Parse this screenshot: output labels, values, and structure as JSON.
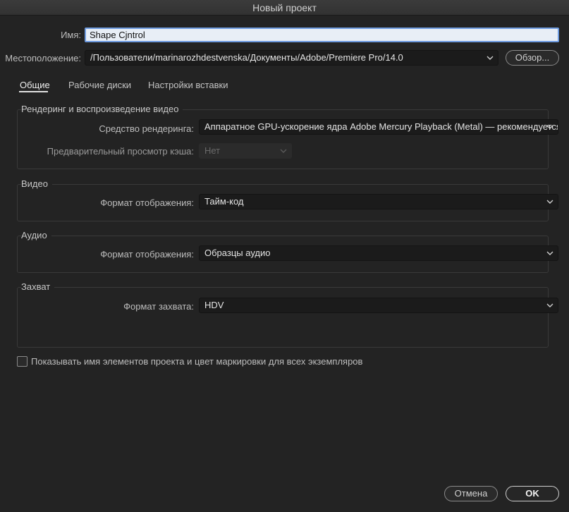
{
  "window": {
    "title": "Новый проект"
  },
  "name": {
    "label": "Имя:",
    "value": "Shape Cjntrol"
  },
  "location": {
    "label": "Местоположение:",
    "value": "/Пользователи/marinarozhdestvenska/Документы/Adobe/Premiere Pro/14.0",
    "browse_button": "Обзор..."
  },
  "tabs": [
    {
      "label": "Общие",
      "active": true
    },
    {
      "label": "Рабочие диски",
      "active": false
    },
    {
      "label": "Настройки вставки",
      "active": false
    }
  ],
  "rendering": {
    "title": "Рендеринг и воспроизведение видео",
    "renderer_label": "Средство рендеринга:",
    "renderer_value": "Аппаратное GPU-ускорение ядра Adobe Mercury Playback (Metal)  — рекомендуется",
    "cache_label": "Предварительный просмотр кэша:",
    "cache_value": "Нет"
  },
  "video": {
    "title": "Видео",
    "display_label": "Формат отображения:",
    "display_value": "Тайм-код"
  },
  "audio": {
    "title": "Аудио",
    "display_label": "Формат отображения:",
    "display_value": "Образцы аудио"
  },
  "capture": {
    "title": "Захват",
    "format_label": "Формат захвата:",
    "format_value": "HDV"
  },
  "options": {
    "show_names_label": "Показывать имя элементов проекта и цвет маркировки для всех экземпляров",
    "show_names_checked": false
  },
  "footer": {
    "cancel": "Отмена",
    "ok": "OK"
  },
  "colors": {
    "background": "#232323",
    "field": "#1b1b1b",
    "name_field": "#e8eef6",
    "focus_ring": "#6e9be0"
  }
}
